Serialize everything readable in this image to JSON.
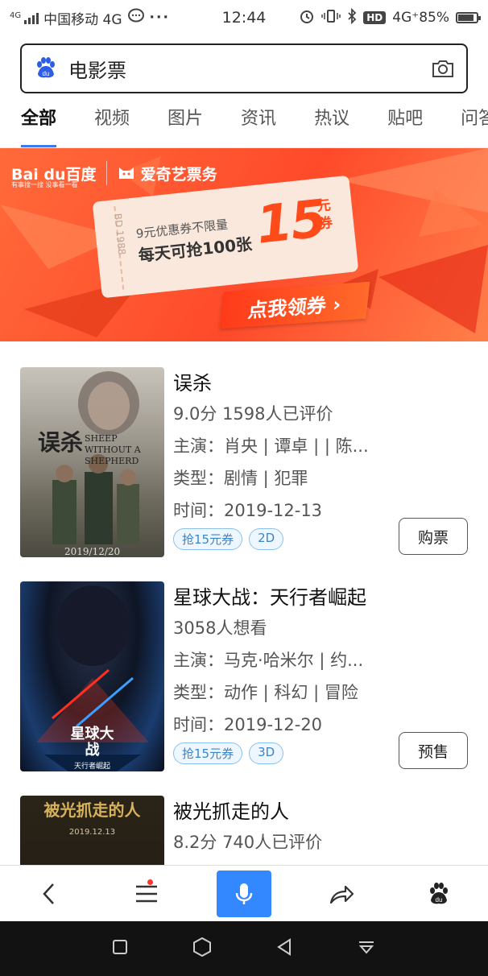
{
  "status": {
    "network_label": "4G",
    "carrier": "中国移动 4G",
    "time": "12:44",
    "hd": "HD",
    "battery": "4G⁺85%",
    "battery_level": 0.85
  },
  "search": {
    "query": "电影票"
  },
  "tabs": [
    "全部",
    "视频",
    "图片",
    "资讯",
    "热议",
    "贴吧",
    "问答"
  ],
  "banner": {
    "brand1": "Bai du百度",
    "brand_slogan": "有事搜一搜 没事看一看",
    "brand2": "爱奇艺票务",
    "line1": "9元优惠券不限量",
    "line2": "每天可抢100张",
    "big_number": "15",
    "unit": "元券",
    "cta": "点我领券 ›",
    "stub_text": "BD 1988"
  },
  "movies": [
    {
      "title": "误杀",
      "line1": "9.0分  1598人已评价",
      "line2": "主演：肖央 | 谭卓 | | 陈...",
      "line3": "类型：剧情 | 犯罪",
      "line4": "时间：2019-12-13",
      "badges": [
        "抢15元券",
        "2D"
      ],
      "button": "购票",
      "poster_title": "误杀",
      "poster_subtitle": "SHEEP WITHOUT A SHEPHERD",
      "poster_date": "2019/12/20"
    },
    {
      "title": "星球大战：天行者崛起",
      "line1": "3058人想看",
      "line2": "主演：马克·哈米尔 | 约...",
      "line3": "类型：动作 | 科幻 | 冒险",
      "line4": "时间：2019-12-20",
      "badges": [
        "抢15元券",
        "3D"
      ],
      "button": "预售",
      "poster_title": "星球大战",
      "poster_subtitle": "天行者崛起"
    },
    {
      "title": "被光抓走的人",
      "line1": "8.2分  740人已评价",
      "poster_title": "被光抓走的人",
      "poster_date": "2019.12.13"
    }
  ],
  "colors": {
    "accent": "#3a7bf0",
    "banner": "#ff5a32",
    "voice": "#3388ff"
  }
}
